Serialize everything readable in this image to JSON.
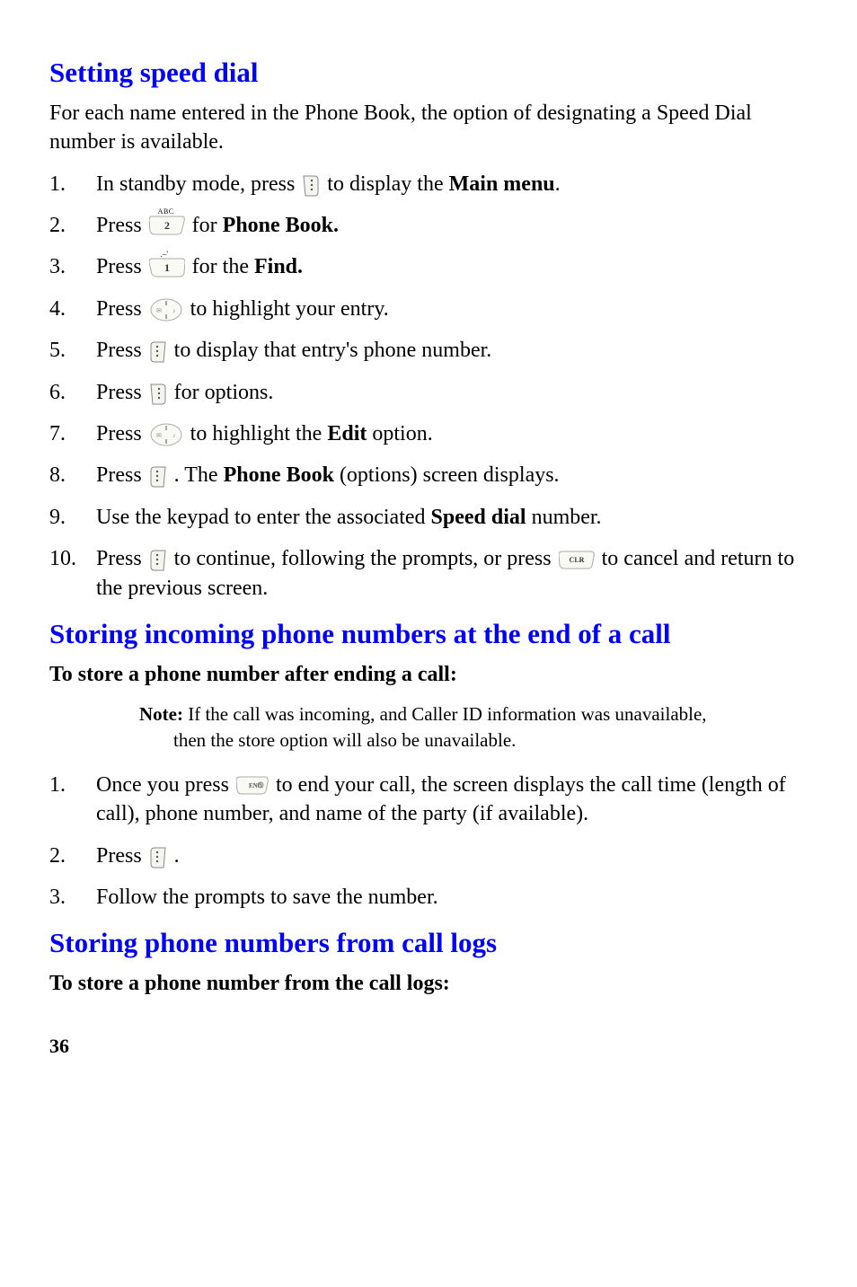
{
  "section1": {
    "title": "Setting speed dial",
    "intro": "For each name entered in the Phone Book, the option of designating a Speed Dial number is available.",
    "steps": [
      {
        "n": "1.",
        "pre": "In standby mode, press ",
        "icon": "softkey",
        "post1": "  to display the ",
        "bold": "Main menu",
        "post2": "."
      },
      {
        "n": "2.",
        "pre": "Press",
        "icon": "key2",
        "post1": "for ",
        "bold": "Phone Book.",
        "post2": ""
      },
      {
        "n": "3.",
        "pre": "Press ",
        "icon": "key1",
        "post1": " for the ",
        "bold": "Find.",
        "post2": ""
      },
      {
        "n": "4.",
        "pre": "Press",
        "icon": "nav",
        "post1": "to highlight your entry.",
        "bold": "",
        "post2": ""
      },
      {
        "n": "5.",
        "pre": "Press  ",
        "icon": "softright",
        "post1": "  to display that entry's phone number.",
        "bold": "",
        "post2": ""
      },
      {
        "n": "6.",
        "pre": "Press ",
        "icon": "softkey",
        "post1": "   for options.",
        "bold": "",
        "post2": ""
      },
      {
        "n": "7.",
        "pre": "Press",
        "icon": "nav",
        "post1": "to highlight the ",
        "bold": "Edit",
        "post2": " option."
      },
      {
        "n": "8.",
        "pre": "Press  ",
        "icon": "softright",
        "post1": " . The ",
        "bold": "Phone Book",
        "post2": " (options) screen displays."
      },
      {
        "n": "9.",
        "pre": "Use the keypad to enter the associated ",
        "icon": "",
        "post1": "",
        "bold": "Speed dial",
        "post2": " number."
      },
      {
        "n": "10.",
        "pre": "Press  ",
        "icon": "softright",
        "post1": " to continue, following the prompts, or press ",
        "icon2": "clr",
        "post2": " to cancel and return to the previous screen.",
        "bold": ""
      }
    ]
  },
  "section2": {
    "title": "Storing incoming phone numbers at the end of a call",
    "subhead": "To store a phone number after ending a call:",
    "note_label": "Note:",
    "note_text_line1": " If the call was incoming, and Caller ID information was unavailable,",
    "note_text_line2": "then the store option will also be unavailable.",
    "steps": [
      {
        "n": "1.",
        "pre": "Once you press ",
        "icon": "end",
        "post1": " to end your call, the screen displays the call time (length of call), phone number, and name of the party (if available).",
        "bold": "",
        "post2": ""
      },
      {
        "n": "2.",
        "pre": "Press  ",
        "icon": "softright",
        "post1": "  .",
        "bold": "",
        "post2": ""
      },
      {
        "n": "3.",
        "pre": "Follow the prompts to save the number.",
        "icon": "",
        "post1": "",
        "bold": "",
        "post2": ""
      }
    ]
  },
  "section3": {
    "title": "Storing phone numbers from call logs",
    "subhead": "To store a phone number from the call logs:"
  },
  "page_number": "36",
  "icons": {
    "key2_label": "ABC",
    "key2_digit": "2",
    "key1_digit": "1",
    "clr_label": "CLR",
    "end_label": "END"
  }
}
